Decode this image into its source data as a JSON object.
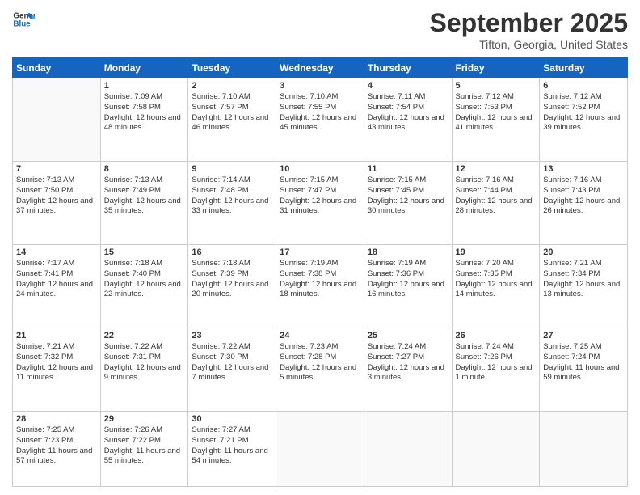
{
  "header": {
    "logo_line1": "General",
    "logo_line2": "Blue",
    "month_title": "September 2025",
    "location": "Tifton, Georgia, United States"
  },
  "days_of_week": [
    "Sunday",
    "Monday",
    "Tuesday",
    "Wednesday",
    "Thursday",
    "Friday",
    "Saturday"
  ],
  "weeks": [
    [
      {
        "day": "",
        "empty": true
      },
      {
        "day": "1",
        "sunrise": "Sunrise: 7:09 AM",
        "sunset": "Sunset: 7:58 PM",
        "daylight": "Daylight: 12 hours and 48 minutes."
      },
      {
        "day": "2",
        "sunrise": "Sunrise: 7:10 AM",
        "sunset": "Sunset: 7:57 PM",
        "daylight": "Daylight: 12 hours and 46 minutes."
      },
      {
        "day": "3",
        "sunrise": "Sunrise: 7:10 AM",
        "sunset": "Sunset: 7:55 PM",
        "daylight": "Daylight: 12 hours and 45 minutes."
      },
      {
        "day": "4",
        "sunrise": "Sunrise: 7:11 AM",
        "sunset": "Sunset: 7:54 PM",
        "daylight": "Daylight: 12 hours and 43 minutes."
      },
      {
        "day": "5",
        "sunrise": "Sunrise: 7:12 AM",
        "sunset": "Sunset: 7:53 PM",
        "daylight": "Daylight: 12 hours and 41 minutes."
      },
      {
        "day": "6",
        "sunrise": "Sunrise: 7:12 AM",
        "sunset": "Sunset: 7:52 PM",
        "daylight": "Daylight: 12 hours and 39 minutes."
      }
    ],
    [
      {
        "day": "7",
        "sunrise": "Sunrise: 7:13 AM",
        "sunset": "Sunset: 7:50 PM",
        "daylight": "Daylight: 12 hours and 37 minutes."
      },
      {
        "day": "8",
        "sunrise": "Sunrise: 7:13 AM",
        "sunset": "Sunset: 7:49 PM",
        "daylight": "Daylight: 12 hours and 35 minutes."
      },
      {
        "day": "9",
        "sunrise": "Sunrise: 7:14 AM",
        "sunset": "Sunset: 7:48 PM",
        "daylight": "Daylight: 12 hours and 33 minutes."
      },
      {
        "day": "10",
        "sunrise": "Sunrise: 7:15 AM",
        "sunset": "Sunset: 7:47 PM",
        "daylight": "Daylight: 12 hours and 31 minutes."
      },
      {
        "day": "11",
        "sunrise": "Sunrise: 7:15 AM",
        "sunset": "Sunset: 7:45 PM",
        "daylight": "Daylight: 12 hours and 30 minutes."
      },
      {
        "day": "12",
        "sunrise": "Sunrise: 7:16 AM",
        "sunset": "Sunset: 7:44 PM",
        "daylight": "Daylight: 12 hours and 28 minutes."
      },
      {
        "day": "13",
        "sunrise": "Sunrise: 7:16 AM",
        "sunset": "Sunset: 7:43 PM",
        "daylight": "Daylight: 12 hours and 26 minutes."
      }
    ],
    [
      {
        "day": "14",
        "sunrise": "Sunrise: 7:17 AM",
        "sunset": "Sunset: 7:41 PM",
        "daylight": "Daylight: 12 hours and 24 minutes."
      },
      {
        "day": "15",
        "sunrise": "Sunrise: 7:18 AM",
        "sunset": "Sunset: 7:40 PM",
        "daylight": "Daylight: 12 hours and 22 minutes."
      },
      {
        "day": "16",
        "sunrise": "Sunrise: 7:18 AM",
        "sunset": "Sunset: 7:39 PM",
        "daylight": "Daylight: 12 hours and 20 minutes."
      },
      {
        "day": "17",
        "sunrise": "Sunrise: 7:19 AM",
        "sunset": "Sunset: 7:38 PM",
        "daylight": "Daylight: 12 hours and 18 minutes."
      },
      {
        "day": "18",
        "sunrise": "Sunrise: 7:19 AM",
        "sunset": "Sunset: 7:36 PM",
        "daylight": "Daylight: 12 hours and 16 minutes."
      },
      {
        "day": "19",
        "sunrise": "Sunrise: 7:20 AM",
        "sunset": "Sunset: 7:35 PM",
        "daylight": "Daylight: 12 hours and 14 minutes."
      },
      {
        "day": "20",
        "sunrise": "Sunrise: 7:21 AM",
        "sunset": "Sunset: 7:34 PM",
        "daylight": "Daylight: 12 hours and 13 minutes."
      }
    ],
    [
      {
        "day": "21",
        "sunrise": "Sunrise: 7:21 AM",
        "sunset": "Sunset: 7:32 PM",
        "daylight": "Daylight: 12 hours and 11 minutes."
      },
      {
        "day": "22",
        "sunrise": "Sunrise: 7:22 AM",
        "sunset": "Sunset: 7:31 PM",
        "daylight": "Daylight: 12 hours and 9 minutes."
      },
      {
        "day": "23",
        "sunrise": "Sunrise: 7:22 AM",
        "sunset": "Sunset: 7:30 PM",
        "daylight": "Daylight: 12 hours and 7 minutes."
      },
      {
        "day": "24",
        "sunrise": "Sunrise: 7:23 AM",
        "sunset": "Sunset: 7:28 PM",
        "daylight": "Daylight: 12 hours and 5 minutes."
      },
      {
        "day": "25",
        "sunrise": "Sunrise: 7:24 AM",
        "sunset": "Sunset: 7:27 PM",
        "daylight": "Daylight: 12 hours and 3 minutes."
      },
      {
        "day": "26",
        "sunrise": "Sunrise: 7:24 AM",
        "sunset": "Sunset: 7:26 PM",
        "daylight": "Daylight: 12 hours and 1 minute."
      },
      {
        "day": "27",
        "sunrise": "Sunrise: 7:25 AM",
        "sunset": "Sunset: 7:24 PM",
        "daylight": "Daylight: 11 hours and 59 minutes."
      }
    ],
    [
      {
        "day": "28",
        "sunrise": "Sunrise: 7:25 AM",
        "sunset": "Sunset: 7:23 PM",
        "daylight": "Daylight: 11 hours and 57 minutes."
      },
      {
        "day": "29",
        "sunrise": "Sunrise: 7:26 AM",
        "sunset": "Sunset: 7:22 PM",
        "daylight": "Daylight: 11 hours and 55 minutes."
      },
      {
        "day": "30",
        "sunrise": "Sunrise: 7:27 AM",
        "sunset": "Sunset: 7:21 PM",
        "daylight": "Daylight: 11 hours and 54 minutes."
      },
      {
        "day": "",
        "empty": true
      },
      {
        "day": "",
        "empty": true
      },
      {
        "day": "",
        "empty": true
      },
      {
        "day": "",
        "empty": true
      }
    ]
  ]
}
